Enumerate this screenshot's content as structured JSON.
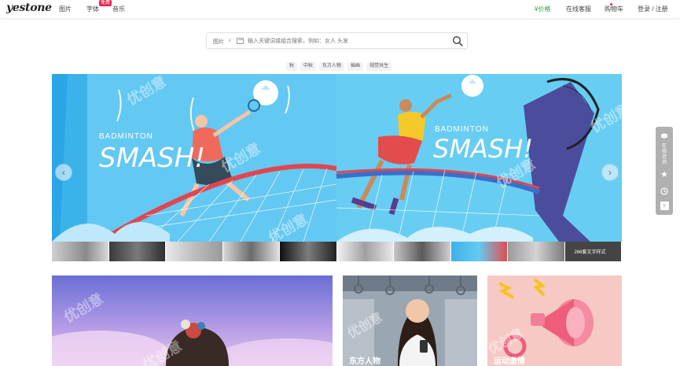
{
  "header": {
    "logo": "yestone",
    "nav": {
      "images": "图片",
      "fonts": "字体",
      "free_badge": "免费",
      "music": "音乐"
    },
    "price": "¥价格",
    "customer_service": "在线客服",
    "cart": "购物车",
    "login": "登录 / 注册"
  },
  "search": {
    "type": "图片",
    "placeholder": "输入关键词或组合搜索，例如：女人 头发"
  },
  "tags": [
    "秋",
    "中秋",
    "东方人物",
    "插画",
    "视觉共生"
  ],
  "banner": {
    "left_text": "BADMINTON",
    "left_title": "SMASH!",
    "right_text": "BADMINTON",
    "right_title": "SMASH!",
    "watermark": "优创意"
  },
  "thumb_labels": {
    "t9": "266套文字样式"
  },
  "side_tool": {
    "service": "在线咨询"
  },
  "cards": [
    {
      "title": ""
    },
    {
      "title": "东方人物"
    },
    {
      "title": "运动激情"
    }
  ],
  "colors": {
    "accent": "#e6274f",
    "price": "#28a745",
    "banner_sky": "#5fc3f0"
  }
}
